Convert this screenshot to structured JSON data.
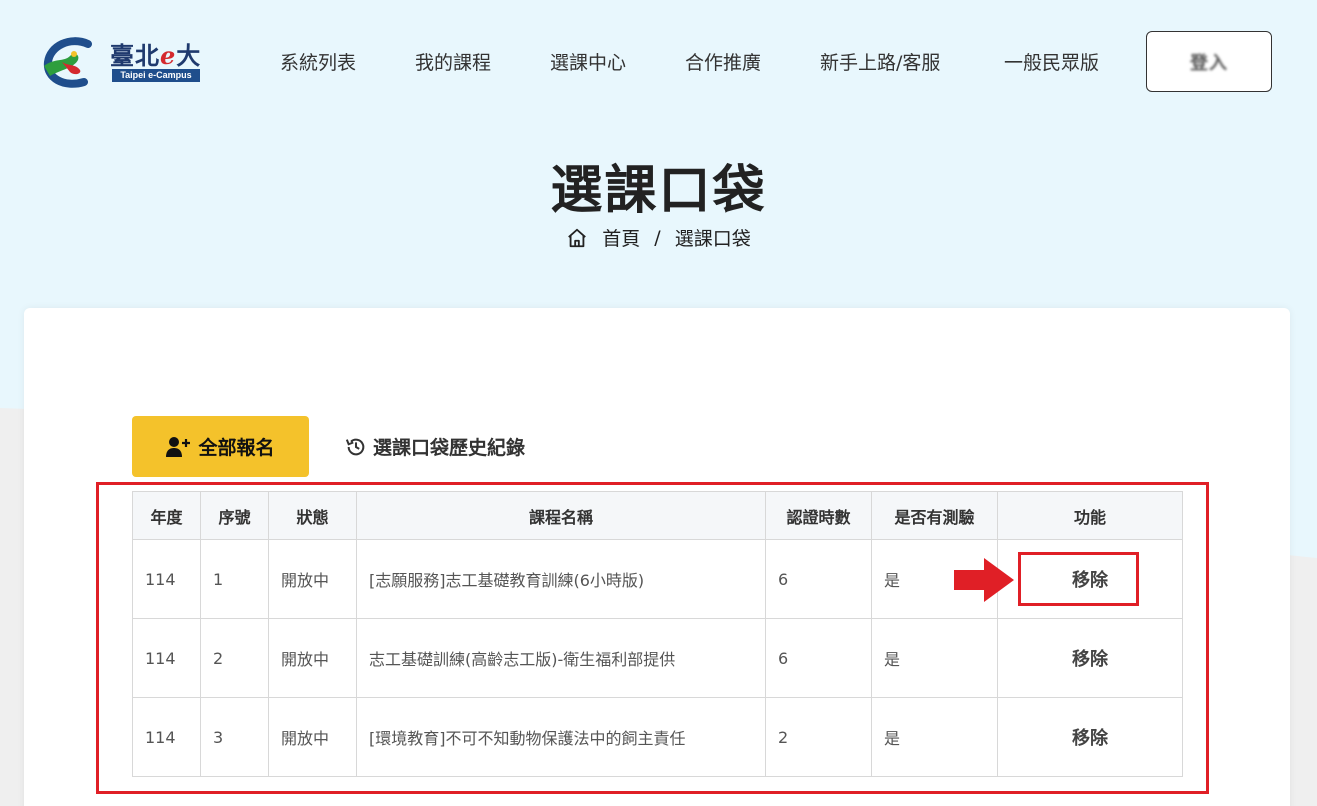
{
  "header": {
    "logo_text_a": "臺北",
    "logo_text_e": "e",
    "logo_text_b": "大",
    "logo_sub": "Taipei e-Campus",
    "nav": [
      "系統列表",
      "我的課程",
      "選課中心",
      "合作推廣",
      "新手上路/客服",
      "一般民眾版"
    ],
    "login_label": "登入"
  },
  "page": {
    "title": "選課口袋",
    "breadcrumb": {
      "home": "首頁",
      "separator": "/",
      "current": "選課口袋"
    }
  },
  "actions": {
    "enroll_all": "全部報名",
    "history": "選課口袋歷史紀錄"
  },
  "table": {
    "headers": [
      "年度",
      "序號",
      "狀態",
      "課程名稱",
      "認證時數",
      "是否有測驗",
      "功能"
    ],
    "rows": [
      {
        "year": "114",
        "no": "1",
        "status": "開放中",
        "course": "[志願服務]志工基礎教育訓練(6小時版)",
        "hours": "6",
        "quiz": "是",
        "action": "移除"
      },
      {
        "year": "114",
        "no": "2",
        "status": "開放中",
        "course": "志工基礎訓練(高齡志工版)-衛生福利部提供",
        "hours": "6",
        "quiz": "是",
        "action": "移除"
      },
      {
        "year": "114",
        "no": "3",
        "status": "開放中",
        "course": "[環境教育]不可不知動物保護法中的飼主責任",
        "hours": "2",
        "quiz": "是",
        "action": "移除"
      }
    ]
  },
  "colors": {
    "hero_bg": "#e8f7fd",
    "accent_yellow": "#f4c22b",
    "highlight_red": "#e01f26"
  }
}
